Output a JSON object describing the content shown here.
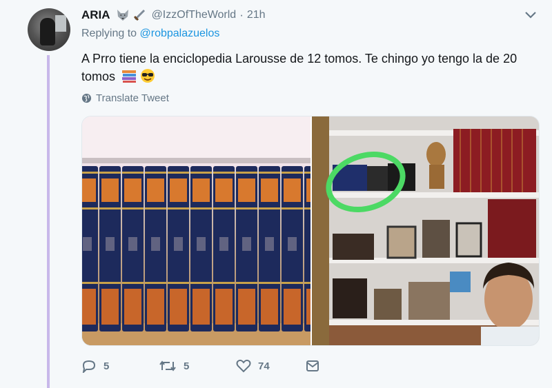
{
  "tweet": {
    "name": "ARIA",
    "handle": "@IzzOfTheWorld",
    "time": "21h",
    "replying_prefix": "Replying to",
    "replying_to": "@robpalazuelos",
    "text": "A Prro tiene la enciclopedia Larousse de 12 tomos. Te chingo yo tengo la de 20 tomos",
    "translate": "Translate Tweet",
    "replies": "5",
    "retweets": "5",
    "likes": "74"
  },
  "colors": {
    "background": "#f5f8fa",
    "muted": "#657786",
    "link": "#1b95e0",
    "thread": "#c8b8ea",
    "highlight_circle": "#4cd964"
  },
  "icons": [
    "wolf-emoji-icon",
    "sword-emoji-icon",
    "books-emoji-icon",
    "sunglasses-emoji-icon",
    "chevron-down-icon",
    "globe-icon",
    "reply-icon",
    "retweet-icon",
    "like-icon",
    "dm-icon"
  ]
}
